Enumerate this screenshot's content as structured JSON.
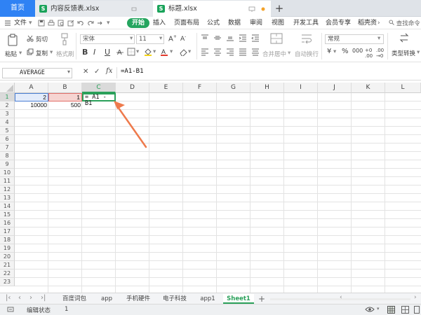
{
  "tabs": {
    "home": "首页",
    "doc1": "内容反馈表.xlsx",
    "doc2": "标题.xlsx",
    "new_tab": "+"
  },
  "menu": {
    "items": [
      "文件",
      "开始",
      "插入",
      "页面布局",
      "公式",
      "数据",
      "审阅",
      "视图",
      "开发工具",
      "会员专享",
      "稻壳资"
    ],
    "search": "查找命令"
  },
  "ribbon": {
    "paste": "粘贴",
    "cut": "剪切",
    "copy": "复制",
    "format_painter": "格式刷",
    "font_name": "宋体",
    "font_size": "11",
    "bold": "B",
    "italic": "I",
    "underline": "U",
    "merge_center": "合并居中",
    "wrap_text": "自动换行",
    "number_format": "常规",
    "currency": "¥",
    "percent": "%",
    "type_convert": "类型转换"
  },
  "formula_bar": {
    "name_box": "AVERAGE",
    "cancel": "✕",
    "confirm": "✓",
    "fx": "fx",
    "formula": "=A1-B1"
  },
  "sheet": {
    "columns": [
      "A",
      "B",
      "C",
      "D",
      "E",
      "F",
      "G",
      "H",
      "I",
      "J",
      "K",
      "L"
    ],
    "rows": [
      "1",
      "2",
      "3",
      "4",
      "5",
      "6",
      "7",
      "8",
      "9",
      "10",
      "11",
      "12",
      "13",
      "14",
      "15",
      "16",
      "17",
      "18",
      "19",
      "20",
      "21",
      "22",
      "23"
    ],
    "cells": {
      "A1": "2",
      "B1": "1",
      "C1": "= A1 - B1",
      "A2": "10000",
      "B2": "500"
    },
    "colors": {
      "a1_ref": "#4a7fd4",
      "b1_ref": "#e2706a",
      "active": "#2aa05a",
      "arrow": "#ee7a4c"
    }
  },
  "sheet_tabs": {
    "items": [
      "百度词包",
      "app",
      "手机硬件",
      "电子科技",
      "app1",
      "Sheet1"
    ],
    "active": "Sheet1",
    "add": "+"
  },
  "status": {
    "mode": "编辑状态",
    "value": "1"
  }
}
